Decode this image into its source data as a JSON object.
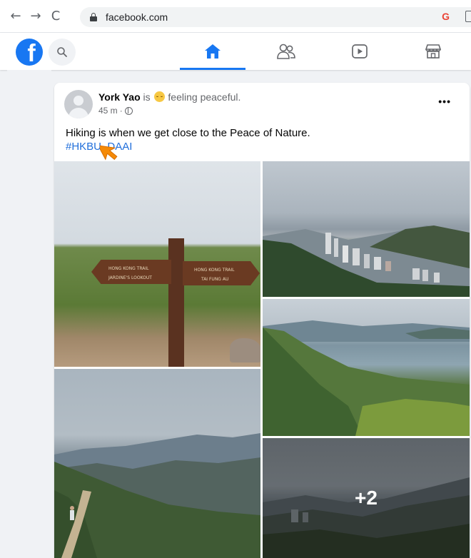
{
  "browser": {
    "url": "facebook.com",
    "back_icon": "←",
    "forward_icon": "→",
    "reload_icon": "C",
    "google_icon": "G"
  },
  "fb": {
    "logo_letter": "f",
    "brand_color": "#1877f2"
  },
  "post": {
    "author": "York Yao",
    "feeling_pre": "is",
    "feeling_text": "feeling peaceful.",
    "time": "45 m",
    "more_label": "•••",
    "text": "Hiking is when we get close to the Peace of Nature.",
    "hashtag": "#HKBU_DAAI",
    "more_photos": "+2",
    "sign_left_top": "HONG KONG TRAIL",
    "sign_left_bottom": "JARDINE'S LOOKOUT",
    "sign_right_top": "HONG KONG TRAIL",
    "sign_right_bottom": "TAI FUNG AU"
  }
}
